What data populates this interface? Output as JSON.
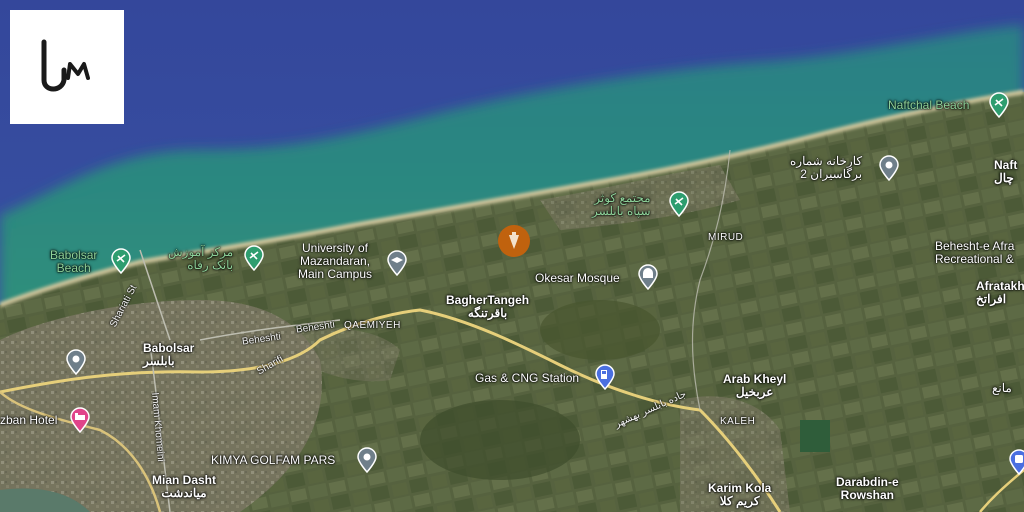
{
  "app": {
    "logo_icon": "um-logo-icon"
  },
  "colors": {
    "sea": "#3a4fa3",
    "shallow_water": "#2f8a6e",
    "land": "#56623f",
    "road": "#e6cf7a",
    "pin_green": "#2e9d6f",
    "pin_gray": "#6f7f8a",
    "pin_blue": "#4a6fe0",
    "pin_pink": "#e0448a",
    "pin_orange": "#c0620e"
  },
  "places": {
    "babolsar_beach": "Babolsar\nBeach",
    "markaz_amoozesh": "مرکز آموزش\nبانک رفاه",
    "university": "University of\nMazandaran,\nMain Campus",
    "okesar_mosque": "Okesar Mosque",
    "majma_kowsar": "مجتمع کوثر\nسپاه بابلسر",
    "karkhaneh": "کارخانه شماره\n2 برگاسیران",
    "naftchal_beach": "Naftchal Beach",
    "naft": "Naft\nچال",
    "mirud": "MIRUD",
    "behesht": "Behesht-e Afra\nRecreational &",
    "afratakh": "Afratakh\nافراتخ",
    "baghertangeh": "BagherTangeh\nباقرتنگه",
    "babolsar": "Babolsar\nبابلسر",
    "qaemiyeh": "QAEMIYEH",
    "gas_station": "Gas & CNG Station",
    "arab_kheyl": "Arab Kheyl\nعربخیل",
    "kaleh": "KALEH",
    "hotel": "zban Hotel",
    "kimya": "KIMYA GOLFAM PARS",
    "mian_dasht": "Mian Dasht\nمیاندشت",
    "karim_kola": "Karim Kola\nکریم کلا",
    "darabdin": "Darabdin-e\nRowshan",
    "manaye": "مانع"
  },
  "roads": {
    "shariati": "Shariati St",
    "beheshti1": "Beheshti",
    "beheshti2": "Beheshti",
    "sharifi": "Sharifi",
    "imam_khomeini": "Imam Khomeini",
    "babolsar_road": "جاده بابلسر بهشهر"
  },
  "markers": [
    {
      "name": "beach-pin-icon",
      "kind": "beach"
    },
    {
      "name": "education-pin-icon",
      "kind": "education"
    },
    {
      "name": "mosque-pin-icon",
      "kind": "mosque"
    },
    {
      "name": "gas-station-pin-icon",
      "kind": "gas"
    },
    {
      "name": "hotel-pin-icon",
      "kind": "hotel"
    },
    {
      "name": "selected-location-pin-icon",
      "kind": "selected"
    }
  ]
}
